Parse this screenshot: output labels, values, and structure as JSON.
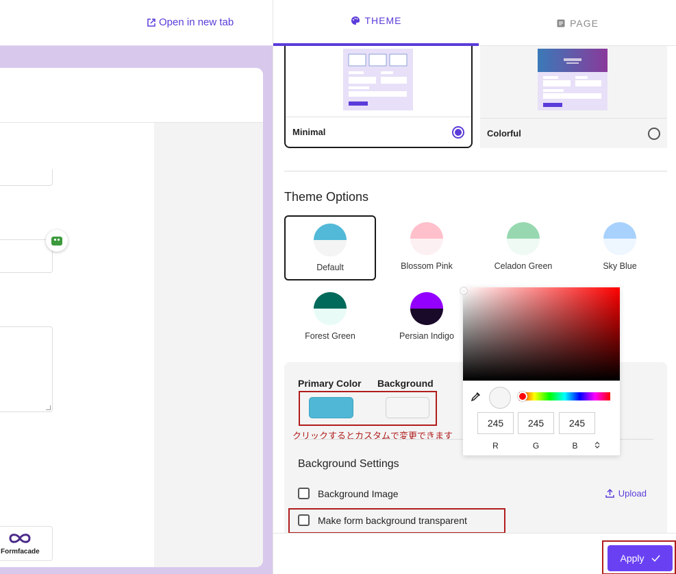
{
  "left": {
    "open_tab_label": "Open in new tab",
    "logo_text": "Formfacade"
  },
  "tabs": [
    {
      "label": "THEME",
      "icon": "palette-icon",
      "active": true
    },
    {
      "label": "PAGE",
      "icon": "document-icon",
      "active": false
    }
  ],
  "layouts": [
    {
      "label": "Minimal",
      "selected": true
    },
    {
      "label": "Colorful",
      "selected": false
    }
  ],
  "theme_options": {
    "title": "Theme Options",
    "swatches": [
      {
        "label": "Default",
        "top": "#52b9d8",
        "bottom": "#f4f4f4",
        "selected": true
      },
      {
        "label": "Blossom Pink",
        "top": "#ffc0cb",
        "bottom": "#fdf0f2",
        "selected": false
      },
      {
        "label": "Celadon Green",
        "top": "#98d8b0",
        "bottom": "#eefaf3",
        "selected": false
      },
      {
        "label": "Sky Blue",
        "top": "#a8d2fd",
        "bottom": "#eef6ff",
        "selected": false
      },
      {
        "label": "Forest Green",
        "top": "#016a5a",
        "bottom": "#e8fbf7",
        "selected": false
      },
      {
        "label": "Persian Indigo",
        "top": "#9400ff",
        "bottom": "#1a0a2a",
        "selected": false
      }
    ]
  },
  "colors": {
    "primary_label": "Primary Color",
    "background_label": "Background",
    "primary_value": "#50b8d6",
    "background_value": "#f5f5f5",
    "accent": "#5b3bd9"
  },
  "annotation": "クリックするとカスタムで変更できます",
  "background_settings": {
    "title": "Background Settings",
    "image_label": "Background Image",
    "upload_label": "Upload",
    "transparent_label": "Make form background transparent"
  },
  "picker": {
    "r": "245",
    "g": "245",
    "b": "245",
    "r_label": "R",
    "g_label": "G",
    "b_label": "B",
    "stepper": "⌃⌄"
  },
  "footer": {
    "apply_label": "Apply"
  }
}
